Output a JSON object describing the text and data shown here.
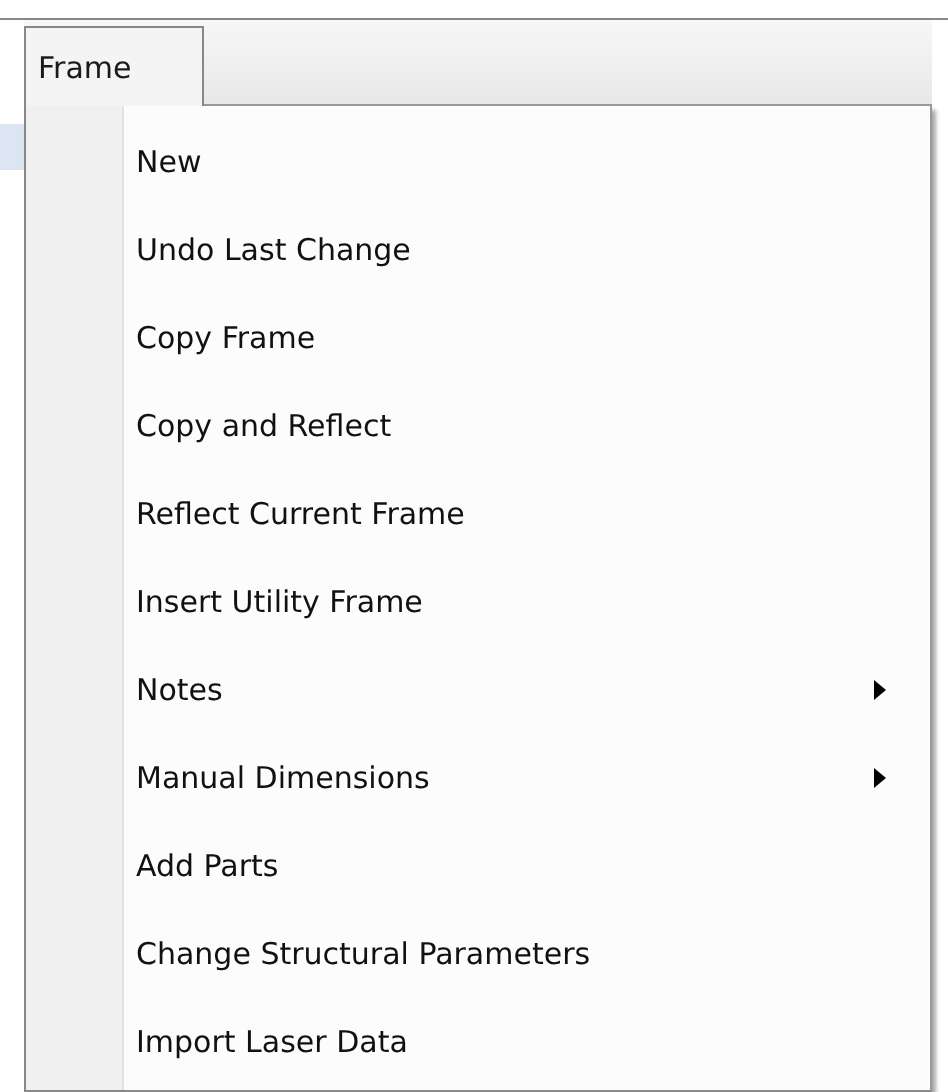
{
  "menu_bar": {
    "title": "Frame"
  },
  "menu": {
    "items": [
      {
        "label": "New",
        "submenu": false
      },
      {
        "label": "Undo Last Change",
        "submenu": false
      },
      {
        "label": "Copy Frame",
        "submenu": false
      },
      {
        "label": "Copy and Reflect",
        "submenu": false
      },
      {
        "label": "Reflect Current Frame",
        "submenu": false
      },
      {
        "label": "Insert Utility Frame",
        "submenu": false
      },
      {
        "label": "Notes",
        "submenu": true
      },
      {
        "label": "Manual Dimensions",
        "submenu": true
      },
      {
        "label": "Add Parts",
        "submenu": false
      },
      {
        "label": "Change Structural Parameters",
        "submenu": false
      },
      {
        "label": "Import Laser Data",
        "submenu": false
      }
    ]
  }
}
